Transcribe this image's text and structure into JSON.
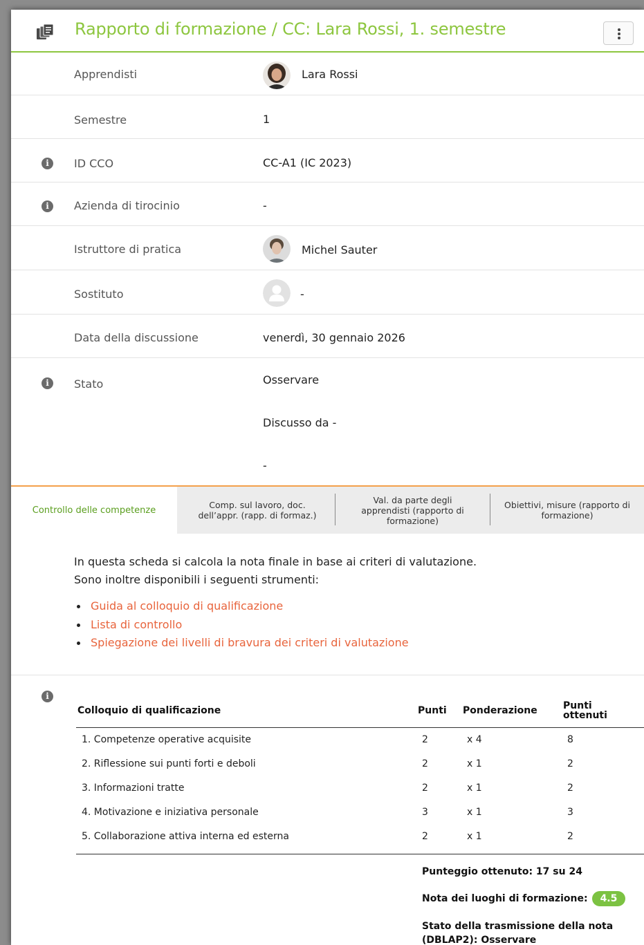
{
  "header": {
    "title": "Rapporto di formazione / CC: Lara Rossi, 1. semestre",
    "icon": "documents-icon",
    "menu_icon": "kebab-menu-icon",
    "accent_color": "#8dc63f"
  },
  "details": {
    "apprendisti": {
      "label": "Apprendisti",
      "value": "Lara Rossi"
    },
    "semestre": {
      "label": "Semestre",
      "value": "1"
    },
    "id_cco": {
      "label": "ID CCO",
      "value": "CC-A1 (IC 2023)"
    },
    "azienda": {
      "label": "Azienda di tirocinio",
      "value": "-"
    },
    "istruttore": {
      "label": "Istruttore di pratica",
      "value": "Michel Sauter"
    },
    "sostituto": {
      "label": "Sostituto",
      "value": "-"
    },
    "data": {
      "label": "Data della discussione",
      "value": "venerdì, 30 gennaio 2026"
    },
    "stato": {
      "label": "Stato",
      "value": "Osservare",
      "discussed": "Discusso da -",
      "extra": "-"
    }
  },
  "tabs": [
    {
      "label": "Controllo delle competenze"
    },
    {
      "label": "Comp. sul lavoro, doc. dell’appr. (rapp. di formaz.)"
    },
    {
      "label": "Val. da parte degli apprendisti (rapporto di formazione)"
    },
    {
      "label": "Obiettivi, misure (rapporto di formazione)"
    }
  ],
  "intro": {
    "line1": "In questa scheda si calcola la nota finale in base ai criteri di valutazione.",
    "line2": "Sono inoltre disponibili i seguenti strumenti:",
    "links": [
      "Guida al colloquio di qualificazione",
      "Lista di controllo",
      "Spiegazione dei livelli di bravura dei criteri di valutazione"
    ],
    "link_color": "#e8643c"
  },
  "table": {
    "headers": [
      "Colloquio di qualificazione",
      "Punti",
      "Ponderazione",
      "Punti ottenuti"
    ],
    "rows": [
      [
        "1. Competenze operative acquisite",
        "2",
        "x 4",
        "8"
      ],
      [
        "2. Riflessione sui punti forti e deboli",
        "2",
        "x 1",
        "2"
      ],
      [
        "3. Informazioni tratte",
        "2",
        "x 1",
        "2"
      ],
      [
        "4. Motivazione e iniziativa personale",
        "3",
        "x 1",
        "3"
      ],
      [
        "5. Collaborazione attiva interna ed esterna",
        "2",
        "x 1",
        "2"
      ]
    ],
    "score": "Punteggio ottenuto: 17 su 24",
    "grade_label": "Nota dei luoghi di formazione:",
    "grade_value": "4.5",
    "transmission": "Stato della trasmissione della nota (DBLAP2): Osservare"
  }
}
